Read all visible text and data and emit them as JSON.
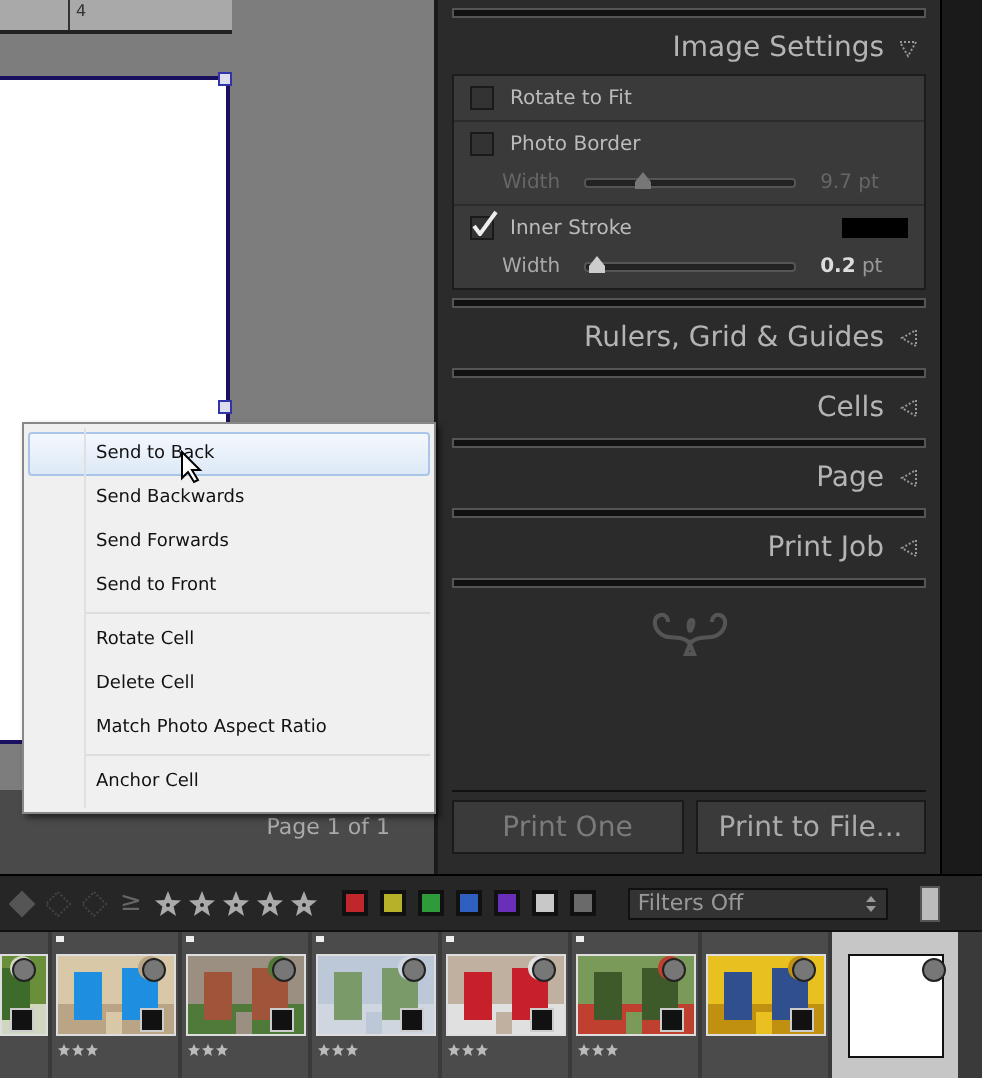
{
  "ruler": {
    "tick_label": "4"
  },
  "canvas": {
    "page_label": "Page 1 of 1"
  },
  "context_menu": {
    "groups": [
      [
        {
          "label": "Send to Back",
          "selected": true
        },
        {
          "label": "Send Backwards",
          "selected": false
        },
        {
          "label": "Send Forwards",
          "selected": false
        },
        {
          "label": "Send to Front",
          "selected": false
        }
      ],
      [
        {
          "label": "Rotate Cell",
          "selected": false
        },
        {
          "label": "Delete Cell",
          "selected": false
        },
        {
          "label": "Match Photo Aspect Ratio",
          "selected": false
        }
      ],
      [
        {
          "label": "Anchor Cell",
          "selected": false
        }
      ]
    ]
  },
  "panel": {
    "sections": [
      {
        "title": "Image Settings",
        "expanded": true,
        "options": [
          {
            "label": "Rotate to Fit",
            "checked": false
          },
          {
            "label": "Photo Border",
            "checked": false,
            "slider": {
              "label": "Width",
              "level": 0.27,
              "reading": "9.7 pt"
            }
          },
          {
            "label": "Inner Stroke",
            "checked": true,
            "slider": {
              "label": "Width",
              "level": 0.05,
              "reading": "**0.2** pt"
            }
          }
        ]
      },
      {
        "title": "Rulers, Grid & Guides",
        "expanded": false
      },
      {
        "title": "Cells",
        "expanded": false
      },
      {
        "title": "Page",
        "expanded": false
      },
      {
        "title": "Print Job",
        "expanded": false
      }
    ],
    "buttons": [
      {
        "label": "Print One",
        "disabled": true
      },
      {
        "label": "Print to File...",
        "disabled": false
      }
    ]
  },
  "filter_bar": {
    "operator": "≥",
    "color_labels": [
      {
        "color": "#c0272d"
      },
      {
        "color": "#b5b22a"
      },
      {
        "color": "#2e9a3a"
      },
      {
        "color": "#2f5fbf"
      },
      {
        "color": "#6a2fb8"
      },
      {
        "color": "#c8c8c8"
      },
      {
        "color": "#6a6a6a"
      }
    ],
    "filters": {
      "value": "Filters Off"
    }
  },
  "filmstrip": {
    "thumbnails": [
      {
        "kind": "picture",
        "flagged": false,
        "selected": false
      },
      {
        "kind": "picture",
        "flagged": true,
        "stars": 3,
        "selected": false
      },
      {
        "kind": "picture",
        "flagged": true,
        "stars": 3,
        "selected": false
      },
      {
        "kind": "picture",
        "flagged": true,
        "stars": 3,
        "selected": false
      },
      {
        "kind": "picture",
        "flagged": true,
        "stars": 3,
        "selected": false
      },
      {
        "kind": "picture",
        "flagged": true,
        "stars": 3,
        "selected": false
      },
      {
        "kind": "picture",
        "flagged": false,
        "selected": false
      },
      {
        "kind": "blank",
        "flagged": false,
        "selected": true
      }
    ]
  }
}
